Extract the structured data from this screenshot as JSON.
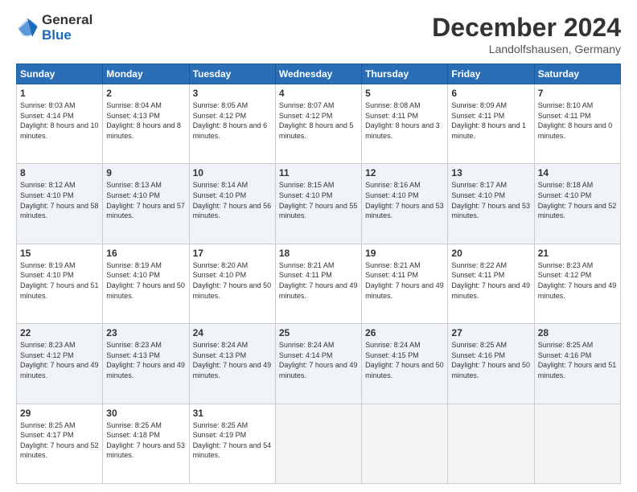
{
  "header": {
    "logo_line1": "General",
    "logo_line2": "Blue",
    "month_title": "December 2024",
    "location": "Landolfshausen, Germany"
  },
  "days_of_week": [
    "Sunday",
    "Monday",
    "Tuesday",
    "Wednesday",
    "Thursday",
    "Friday",
    "Saturday"
  ],
  "weeks": [
    [
      {
        "day": "1",
        "sunrise": "Sunrise: 8:03 AM",
        "sunset": "Sunset: 4:14 PM",
        "daylight": "Daylight: 8 hours and 10 minutes."
      },
      {
        "day": "2",
        "sunrise": "Sunrise: 8:04 AM",
        "sunset": "Sunset: 4:13 PM",
        "daylight": "Daylight: 8 hours and 8 minutes."
      },
      {
        "day": "3",
        "sunrise": "Sunrise: 8:05 AM",
        "sunset": "Sunset: 4:12 PM",
        "daylight": "Daylight: 8 hours and 6 minutes."
      },
      {
        "day": "4",
        "sunrise": "Sunrise: 8:07 AM",
        "sunset": "Sunset: 4:12 PM",
        "daylight": "Daylight: 8 hours and 5 minutes."
      },
      {
        "day": "5",
        "sunrise": "Sunrise: 8:08 AM",
        "sunset": "Sunset: 4:11 PM",
        "daylight": "Daylight: 8 hours and 3 minutes."
      },
      {
        "day": "6",
        "sunrise": "Sunrise: 8:09 AM",
        "sunset": "Sunset: 4:11 PM",
        "daylight": "Daylight: 8 hours and 1 minute."
      },
      {
        "day": "7",
        "sunrise": "Sunrise: 8:10 AM",
        "sunset": "Sunset: 4:11 PM",
        "daylight": "Daylight: 8 hours and 0 minutes."
      }
    ],
    [
      {
        "day": "8",
        "sunrise": "Sunrise: 8:12 AM",
        "sunset": "Sunset: 4:10 PM",
        "daylight": "Daylight: 7 hours and 58 minutes."
      },
      {
        "day": "9",
        "sunrise": "Sunrise: 8:13 AM",
        "sunset": "Sunset: 4:10 PM",
        "daylight": "Daylight: 7 hours and 57 minutes."
      },
      {
        "day": "10",
        "sunrise": "Sunrise: 8:14 AM",
        "sunset": "Sunset: 4:10 PM",
        "daylight": "Daylight: 7 hours and 56 minutes."
      },
      {
        "day": "11",
        "sunrise": "Sunrise: 8:15 AM",
        "sunset": "Sunset: 4:10 PM",
        "daylight": "Daylight: 7 hours and 55 minutes."
      },
      {
        "day": "12",
        "sunrise": "Sunrise: 8:16 AM",
        "sunset": "Sunset: 4:10 PM",
        "daylight": "Daylight: 7 hours and 53 minutes."
      },
      {
        "day": "13",
        "sunrise": "Sunrise: 8:17 AM",
        "sunset": "Sunset: 4:10 PM",
        "daylight": "Daylight: 7 hours and 53 minutes."
      },
      {
        "day": "14",
        "sunrise": "Sunrise: 8:18 AM",
        "sunset": "Sunset: 4:10 PM",
        "daylight": "Daylight: 7 hours and 52 minutes."
      }
    ],
    [
      {
        "day": "15",
        "sunrise": "Sunrise: 8:19 AM",
        "sunset": "Sunset: 4:10 PM",
        "daylight": "Daylight: 7 hours and 51 minutes."
      },
      {
        "day": "16",
        "sunrise": "Sunrise: 8:19 AM",
        "sunset": "Sunset: 4:10 PM",
        "daylight": "Daylight: 7 hours and 50 minutes."
      },
      {
        "day": "17",
        "sunrise": "Sunrise: 8:20 AM",
        "sunset": "Sunset: 4:10 PM",
        "daylight": "Daylight: 7 hours and 50 minutes."
      },
      {
        "day": "18",
        "sunrise": "Sunrise: 8:21 AM",
        "sunset": "Sunset: 4:11 PM",
        "daylight": "Daylight: 7 hours and 49 minutes."
      },
      {
        "day": "19",
        "sunrise": "Sunrise: 8:21 AM",
        "sunset": "Sunset: 4:11 PM",
        "daylight": "Daylight: 7 hours and 49 minutes."
      },
      {
        "day": "20",
        "sunrise": "Sunrise: 8:22 AM",
        "sunset": "Sunset: 4:11 PM",
        "daylight": "Daylight: 7 hours and 49 minutes."
      },
      {
        "day": "21",
        "sunrise": "Sunrise: 8:23 AM",
        "sunset": "Sunset: 4:12 PM",
        "daylight": "Daylight: 7 hours and 49 minutes."
      }
    ],
    [
      {
        "day": "22",
        "sunrise": "Sunrise: 8:23 AM",
        "sunset": "Sunset: 4:12 PM",
        "daylight": "Daylight: 7 hours and 49 minutes."
      },
      {
        "day": "23",
        "sunrise": "Sunrise: 8:23 AM",
        "sunset": "Sunset: 4:13 PM",
        "daylight": "Daylight: 7 hours and 49 minutes."
      },
      {
        "day": "24",
        "sunrise": "Sunrise: 8:24 AM",
        "sunset": "Sunset: 4:13 PM",
        "daylight": "Daylight: 7 hours and 49 minutes."
      },
      {
        "day": "25",
        "sunrise": "Sunrise: 8:24 AM",
        "sunset": "Sunset: 4:14 PM",
        "daylight": "Daylight: 7 hours and 49 minutes."
      },
      {
        "day": "26",
        "sunrise": "Sunrise: 8:24 AM",
        "sunset": "Sunset: 4:15 PM",
        "daylight": "Daylight: 7 hours and 50 minutes."
      },
      {
        "day": "27",
        "sunrise": "Sunrise: 8:25 AM",
        "sunset": "Sunset: 4:16 PM",
        "daylight": "Daylight: 7 hours and 50 minutes."
      },
      {
        "day": "28",
        "sunrise": "Sunrise: 8:25 AM",
        "sunset": "Sunset: 4:16 PM",
        "daylight": "Daylight: 7 hours and 51 minutes."
      }
    ],
    [
      {
        "day": "29",
        "sunrise": "Sunrise: 8:25 AM",
        "sunset": "Sunset: 4:17 PM",
        "daylight": "Daylight: 7 hours and 52 minutes."
      },
      {
        "day": "30",
        "sunrise": "Sunrise: 8:25 AM",
        "sunset": "Sunset: 4:18 PM",
        "daylight": "Daylight: 7 hours and 53 minutes."
      },
      {
        "day": "31",
        "sunrise": "Sunrise: 8:25 AM",
        "sunset": "Sunset: 4:19 PM",
        "daylight": "Daylight: 7 hours and 54 minutes."
      },
      null,
      null,
      null,
      null
    ]
  ]
}
